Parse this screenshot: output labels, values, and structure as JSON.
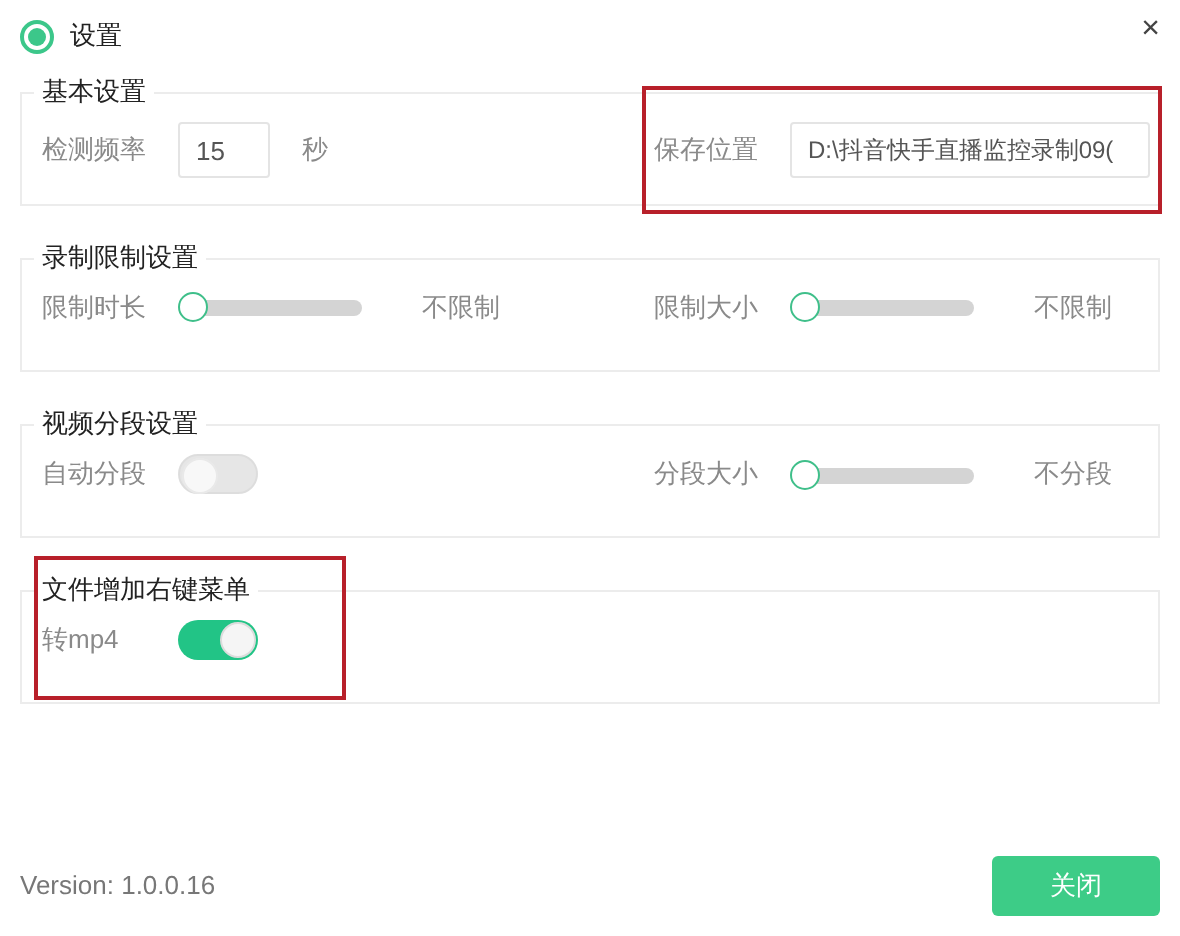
{
  "window": {
    "title": "设置",
    "close": "×"
  },
  "groups": [
    {
      "title": "基本设置",
      "highlighted": false,
      "items": [
        {
          "kind": "number",
          "label": "检测频率",
          "value": "15",
          "unit": "秒",
          "highlighted": false
        },
        {
          "kind": "path",
          "label": "保存位置",
          "value": "D:\\抖音快手直播监控录制09(",
          "highlighted": true
        }
      ]
    },
    {
      "title": "录制限制设置",
      "highlighted": false,
      "items": [
        {
          "kind": "slider",
          "label": "限制时长",
          "level": 0,
          "reading": "不限制",
          "highlighted": false
        },
        {
          "kind": "slider",
          "label": "限制大小",
          "level": 0,
          "reading": "不限制",
          "highlighted": false
        }
      ]
    },
    {
      "title": "视频分段设置",
      "highlighted": false,
      "items": [
        {
          "kind": "toggle",
          "label": "自动分段",
          "on": false,
          "disabled": true,
          "highlighted": false
        },
        {
          "kind": "slider",
          "label": "分段大小",
          "level": 0,
          "reading": "不分段",
          "highlighted": false
        }
      ]
    },
    {
      "title": "文件增加右键菜单",
      "highlighted": true,
      "items": [
        {
          "kind": "toggle",
          "label": "转mp4",
          "on": true,
          "disabled": false,
          "highlighted": false
        }
      ]
    }
  ],
  "footer": {
    "version": "Version:  1.0.0.16",
    "close_button": "关闭"
  }
}
